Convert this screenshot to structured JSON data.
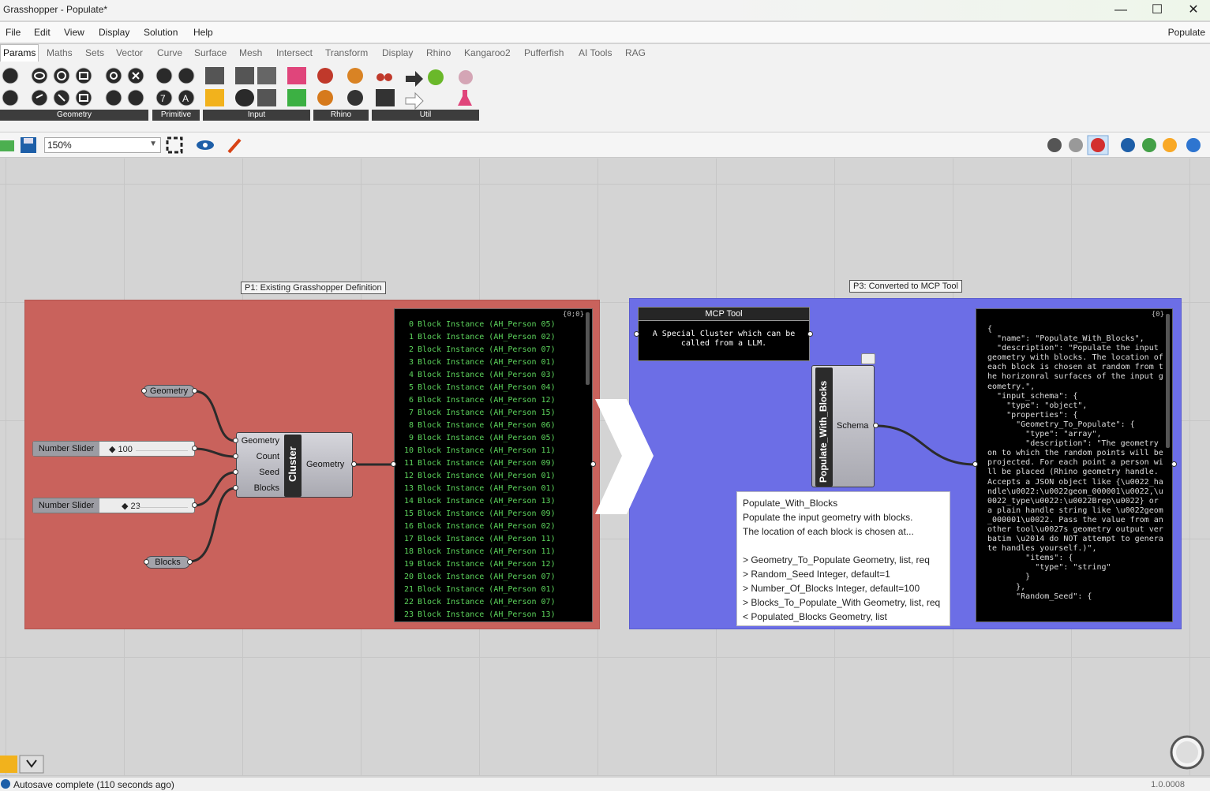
{
  "window": {
    "title": "Grasshopper - Populate*",
    "minimize": "—",
    "maximize": "☐",
    "close": "✕"
  },
  "menu": {
    "items": [
      "File",
      "Edit",
      "View",
      "Display",
      "Solution",
      "Help"
    ],
    "document": "Populate"
  },
  "tabs": [
    "Params",
    "Maths",
    "Sets",
    "Vector",
    "Curve",
    "Surface",
    "Mesh",
    "Intersect",
    "Transform",
    "Display",
    "Rhino",
    "Kangaroo2",
    "Pufferfish",
    "AI Tools",
    "RAG"
  ],
  "ribbon_groups": [
    "Geometry",
    "Primitive",
    "Input",
    "Rhino",
    "Util"
  ],
  "toolbar": {
    "zoom": "150%"
  },
  "canvas": {
    "left_group": {
      "title": "P1: Existing Grasshopper Definition",
      "geometry_param": "Geometry",
      "blocks_param": "Blocks",
      "slider1": {
        "label": "Number Slider",
        "value": "◆ 100"
      },
      "slider2": {
        "label": "Number Slider",
        "value": "◆ 23"
      },
      "cluster": {
        "inputs": [
          "Geometry",
          "Count",
          "Seed",
          "Blocks"
        ],
        "name": "Cluster",
        "output": "Geometry"
      },
      "panel": {
        "path": "{0;0}",
        "rows": [
          "Block Instance (AH_Person 05)",
          "Block Instance (AH_Person 02)",
          "Block Instance (AH_Person 07)",
          "Block Instance (AH_Person 01)",
          "Block Instance (AH_Person 03)",
          "Block Instance (AH_Person 04)",
          "Block Instance (AH_Person 12)",
          "Block Instance (AH_Person 15)",
          "Block Instance (AH_Person 06)",
          "Block Instance (AH_Person 05)",
          "Block Instance (AH_Person 11)",
          "Block Instance (AH_Person 09)",
          "Block Instance (AH_Person 01)",
          "Block Instance (AH_Person 01)",
          "Block Instance (AH_Person 13)",
          "Block Instance (AH_Person 09)",
          "Block Instance (AH_Person 02)",
          "Block Instance (AH_Person 11)",
          "Block Instance (AH_Person 11)",
          "Block Instance (AH_Person 12)",
          "Block Instance (AH_Person 07)",
          "Block Instance (AH_Person 01)",
          "Block Instance (AH_Person 07)",
          "Block Instance (AH_Person 13)"
        ]
      }
    },
    "right_group": {
      "title": "P3: Converted to MCP Tool",
      "mcp_tool": {
        "title": "MCP Tool",
        "body": "A Special Cluster which can be called from a LLM."
      },
      "component": {
        "name": "Populate_With_Blocks",
        "output": "Schema"
      },
      "tooltip": {
        "title": "Populate_With_Blocks",
        "line1": "Populate the input geometry with blocks.",
        "line2": "The location of each block is chosen at...",
        "params": [
          "> Geometry_To_Populate  Geometry, list, req",
          "> Random_Seed  Integer, default=1",
          "> Number_Of_Blocks  Integer, default=100",
          "> Blocks_To_Populate_With  Geometry, list, req",
          "< Populated_Blocks  Geometry, list"
        ]
      },
      "json_panel": {
        "path": "{0}",
        "text": "{\n  \"name\": \"Populate_With_Blocks\",\n  \"description\": \"Populate the input geometry with blocks. The location of each block is chosen at random from the horizonral surfaces of the input geometry.\",\n  \"input_schema\": {\n    \"type\": \"object\",\n    \"properties\": {\n      \"Geometry_To_Populate\": {\n        \"type\": \"array\",\n        \"description\": \"The geometry on to which the random points will be projected. For each point a person will be placed (Rhino geometry handle. Accepts a JSON object like {\\u0022_handle\\u0022:\\u0022geom_000001\\u0022,\\u0022_type\\u0022:\\u0022Brep\\u0022} or a plain handle string like \\u0022geom_000001\\u0022. Pass the value from another tool\\u0027s geometry output verbatim \\u2014 do NOT attempt to generate handles yourself.)\",\n        \"items\": {\n          \"type\": \"string\"\n        }\n      },\n      \"Random_Seed\": {"
      }
    }
  },
  "status": {
    "message": "Autosave complete (110 seconds ago)",
    "version": "1.0.0008"
  }
}
